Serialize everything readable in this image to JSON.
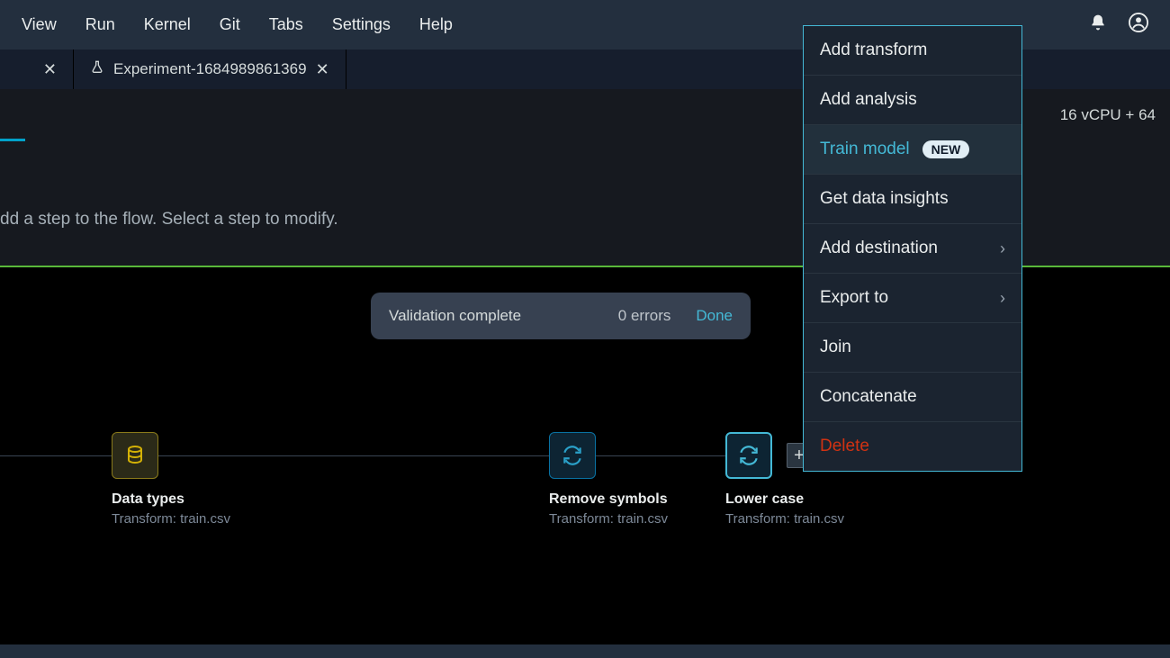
{
  "menubar": {
    "items": [
      "View",
      "Run",
      "Kernel",
      "Git",
      "Tabs",
      "Settings",
      "Help"
    ]
  },
  "icons": {
    "bell": "bell-icon",
    "user": "user-icon",
    "flask": "flask-icon",
    "close": "close-icon",
    "chevron_right": "chevron-right-icon",
    "plus": "plus-icon",
    "database": "database-icon",
    "cycle": "cycle-icon"
  },
  "tabs": {
    "first_close": "✕",
    "second": {
      "label": "Experiment-1684989861369",
      "close": "✕"
    }
  },
  "subheader": {
    "instance": "16 vCPU + 64"
  },
  "instruction": "dd a step to the flow. Select a step to modify.",
  "validation": {
    "status": "Validation complete",
    "errors": "0 errors",
    "done": "Done"
  },
  "nodes": {
    "data": {
      "title": "Data types",
      "sub": "Transform: train.csv"
    },
    "remove": {
      "title": "Remove symbols",
      "sub": "Transform: train.csv"
    },
    "lower": {
      "title": "Lower case",
      "sub": "Transform: train.csv"
    }
  },
  "plus": "+",
  "context_menu": {
    "items": [
      {
        "label": "Add transform",
        "kind": "normal"
      },
      {
        "label": "Add analysis",
        "kind": "normal"
      },
      {
        "label": "Train model",
        "kind": "highlight",
        "badge": "NEW"
      },
      {
        "label": "Get data insights",
        "kind": "normal"
      },
      {
        "label": "Add destination",
        "kind": "submenu"
      },
      {
        "label": "Export to",
        "kind": "submenu"
      },
      {
        "label": "Join",
        "kind": "normal"
      },
      {
        "label": "Concatenate",
        "kind": "normal"
      },
      {
        "label": "Delete",
        "kind": "danger"
      }
    ]
  }
}
